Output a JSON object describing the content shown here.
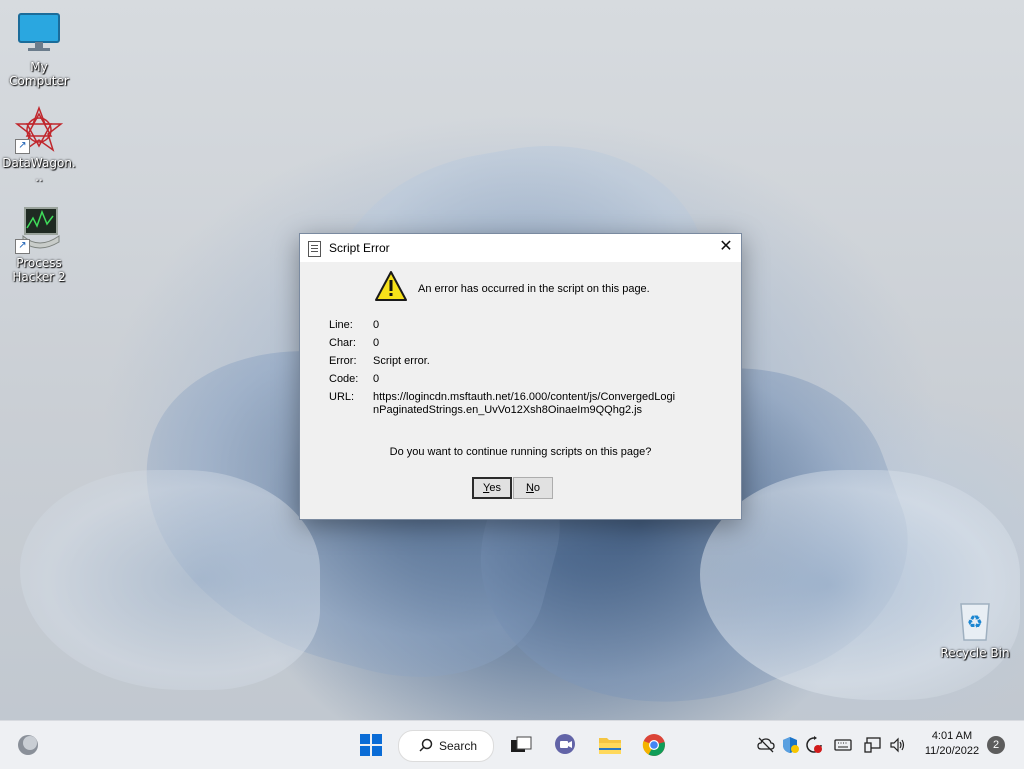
{
  "desktop": {
    "icons": [
      {
        "label": "My Computer",
        "icon": "computer-monitor-icon"
      },
      {
        "label": "DataWagon...",
        "icon": "datawagon-app-icon"
      },
      {
        "label": "Process Hacker 2",
        "icon": "process-hacker-icon"
      },
      {
        "label": "Recycle Bin",
        "icon": "recycle-bin-icon"
      }
    ]
  },
  "dialog": {
    "title": "Script Error",
    "close_glyph": "✕",
    "headline": "An error has occurred in the script on this page.",
    "fields": [
      {
        "label": "Line:",
        "value": "0"
      },
      {
        "label": "Char:",
        "value": "0"
      },
      {
        "label": "Error:",
        "value": "Script error."
      },
      {
        "label": "Code:",
        "value": "0"
      },
      {
        "label": "URL:",
        "value": "https://logincdn.msftauth.net/16.000/content/js/ConvergedLoginPaginatedStrings.en_UvVo12Xsh8OinaeIm9QQhg2.js"
      }
    ],
    "question": "Do you want to continue running scripts on this page?",
    "buttons": {
      "yes_prefix": "",
      "yes_accel": "Y",
      "yes_rest": "es",
      "no_accel": "N",
      "no_rest": "o"
    }
  },
  "taskbar": {
    "search_label": "Search",
    "clock": {
      "time": "4:01 AM",
      "date": "11/20/2022"
    },
    "notification_count": "2",
    "colors": {
      "accent": "#0067c0",
      "background": "#eef0f3"
    }
  }
}
